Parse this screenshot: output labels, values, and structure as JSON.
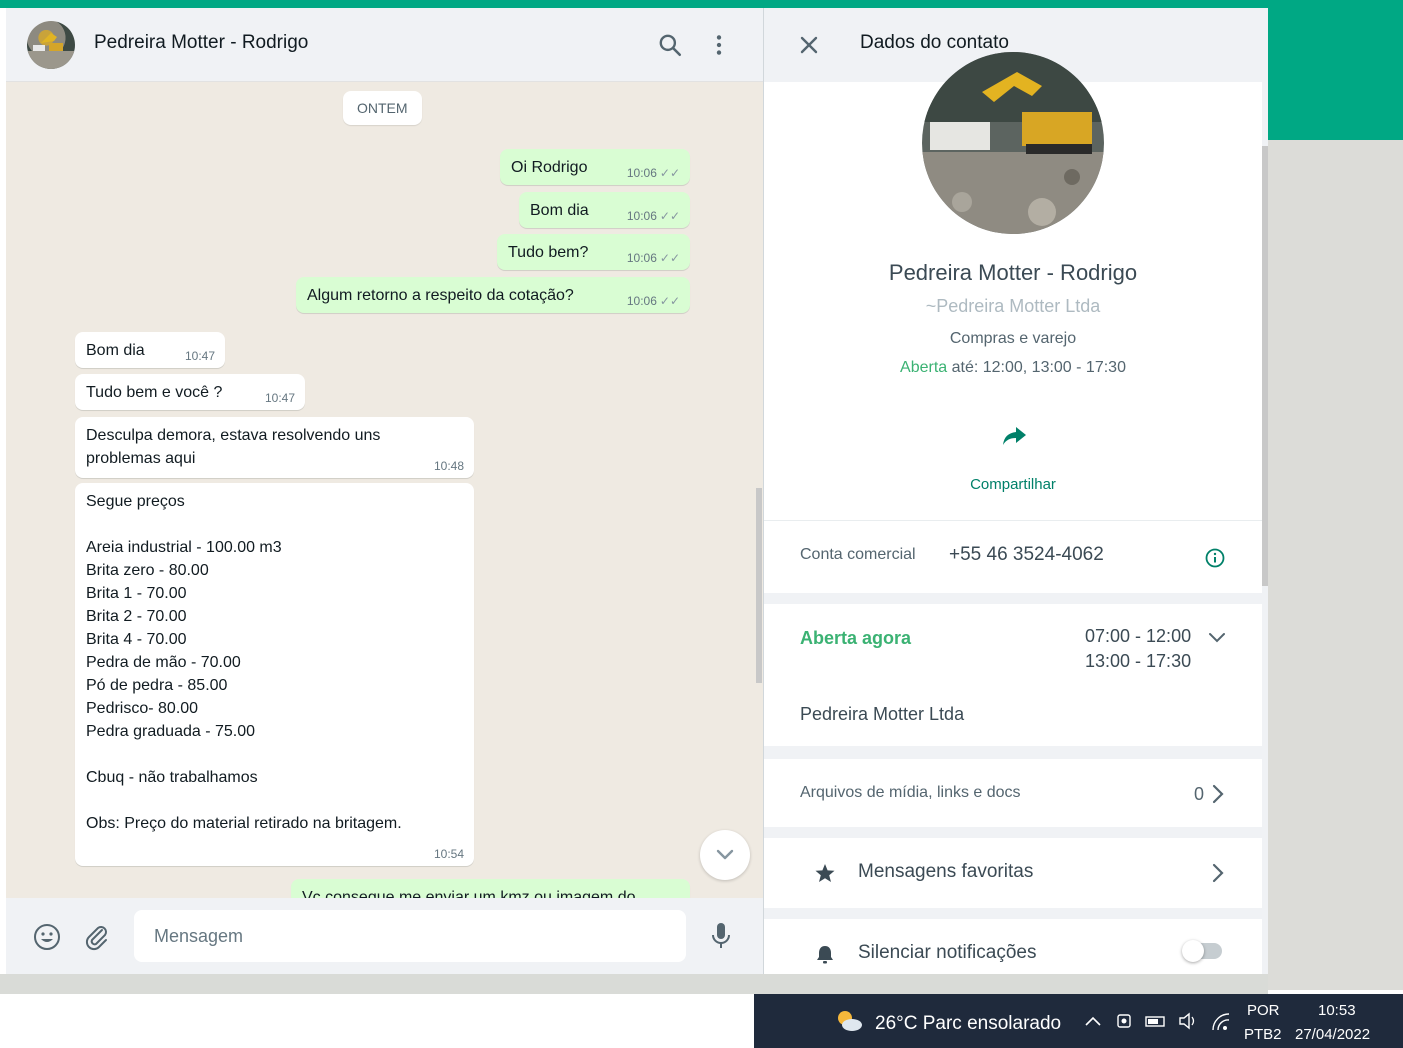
{
  "chat": {
    "contact_name": "Pedreira Motter - Rodrigo",
    "date_chip": "ONTEM",
    "messages": [
      {
        "dir": "out",
        "text": "Oi Rodrigo",
        "time": "10:06"
      },
      {
        "dir": "out",
        "text": "Bom dia",
        "time": "10:06"
      },
      {
        "dir": "out",
        "text": "Tudo bem?",
        "time": "10:06"
      },
      {
        "dir": "out",
        "text": "Algum retorno a respeito da cotação?",
        "time": "10:06"
      },
      {
        "dir": "in",
        "text": "Bom dia",
        "time": "10:47"
      },
      {
        "dir": "in",
        "text": "Tudo bem e você ?",
        "time": "10:47"
      },
      {
        "dir": "in",
        "text": "Desculpa demora, estava resolvendo uns\nproblemas aqui",
        "time": "10:48"
      },
      {
        "dir": "in",
        "text": "Segue preços\n\nAreia industrial - 100.00 m3\nBrita zero - 80.00\nBrita 1 - 70.00\nBrita 2 - 70.00\nBrita 4 - 70.00\nPedra de mão - 70.00\nPó de pedra - 85.00\nPedrisco- 80.00\nPedra graduada - 75.00\n\nCbuq - não trabalhamos\n\nObs: Preço do material retirado na britagem.",
        "time": "10:54"
      },
      {
        "dir": "out",
        "text": "Vc consegue me enviar um kmz ou imagem do",
        "time": ""
      }
    ],
    "composer_placeholder": "Mensagem"
  },
  "contact": {
    "header_title": "Dados do contato",
    "name": "Pedreira Motter - Rodrigo",
    "business_name": "~Pedreira Motter Ltda",
    "category": "Compras e varejo",
    "open_label": "Aberta",
    "hours_summary": " até: 12:00, 13:00 - 17:30",
    "share_label": "Compartilhar",
    "account_label": "Conta comercial",
    "phone": "+55 46 3524-4062",
    "open_now_label": "Aberta agora",
    "hours_line1": "07:00 - 12:00",
    "hours_line2": "13:00 - 17:30",
    "company": "Pedreira Motter Ltda",
    "media_label": "Arquivos de mídia, links e docs",
    "media_count": "0",
    "starred_label": "Mensagens favoritas",
    "mute_label": "Silenciar notificações"
  },
  "taskbar": {
    "weather": "26°C  Parc ensolarado",
    "lang_top": "POR",
    "lang_bottom": "PTB2",
    "time": "10:53",
    "date": "27/04/2022"
  },
  "colors": {
    "accent": "#00a884",
    "outgoing_bubble": "#d9fdd3",
    "open_green": "#3bb273",
    "taskbar": "#1f2a3c"
  },
  "icons": [
    "search-icon",
    "menu-icon",
    "close-icon",
    "emoji-icon",
    "attach-icon",
    "mic-icon",
    "share-icon",
    "info-icon",
    "chevron-down-icon",
    "chevron-right-icon",
    "star-icon",
    "bell-icon",
    "weather-icon",
    "wifi-icon",
    "volume-icon"
  ]
}
